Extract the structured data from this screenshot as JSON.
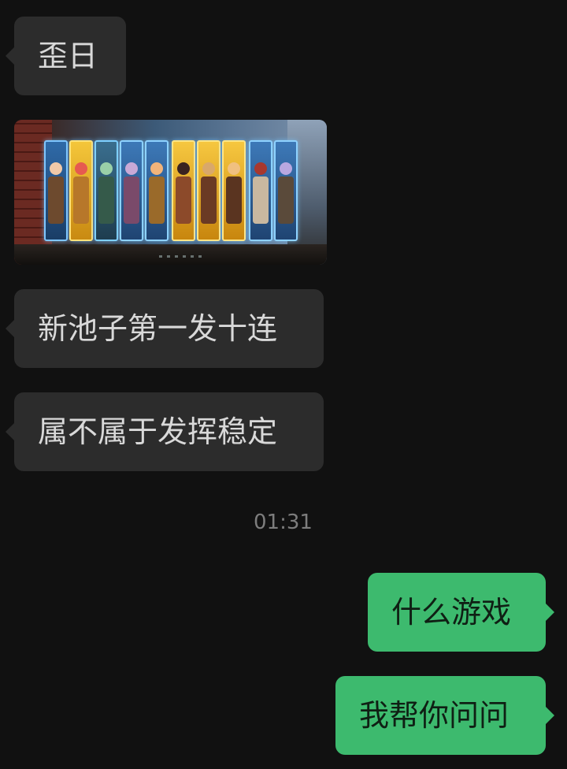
{
  "messages": {
    "m1": {
      "text": "歪日"
    },
    "m2": {
      "text": "新池子第一发十连"
    },
    "m3": {
      "text": "属不属于发挥稳定"
    },
    "timestamp": "01:31",
    "m4": {
      "text": "什么游戏"
    },
    "m5": {
      "text": "我帮你问问"
    }
  },
  "colors": {
    "background": "#111111",
    "incoming_bubble": "#2c2c2c",
    "outgoing_bubble": "#3dba6e",
    "timestamp": "#7d7d7d"
  }
}
